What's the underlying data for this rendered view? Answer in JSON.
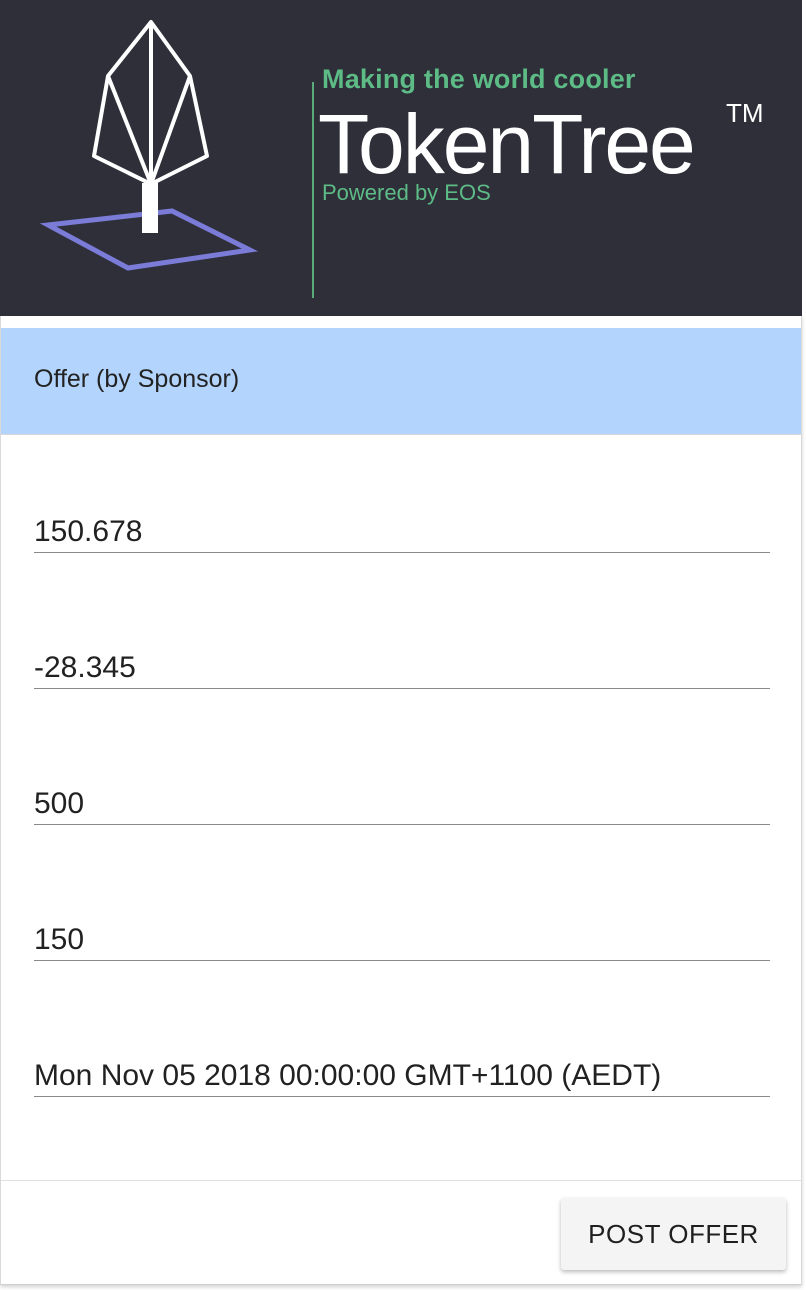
{
  "banner": {
    "tagline": "Making the world cooler",
    "brand_name": "TokenTree",
    "trademark": "TM",
    "powered_by": "Powered by EOS",
    "colors": {
      "background": "#2e2f39",
      "accent_green": "#5dbb86",
      "ground_purple": "#7b7bd8"
    },
    "logo_icon": "tree-logo-icon"
  },
  "card": {
    "title": "Offer (by Sponsor)",
    "header_color": "#b3d4fc",
    "fields": [
      {
        "value": "150.678"
      },
      {
        "value": "-28.345"
      },
      {
        "value": "500"
      },
      {
        "value": "150"
      },
      {
        "value": "Mon Nov 05 2018 00:00:00 GMT+1100 (AEDT)"
      }
    ],
    "post_button_label": "POST OFFER"
  }
}
